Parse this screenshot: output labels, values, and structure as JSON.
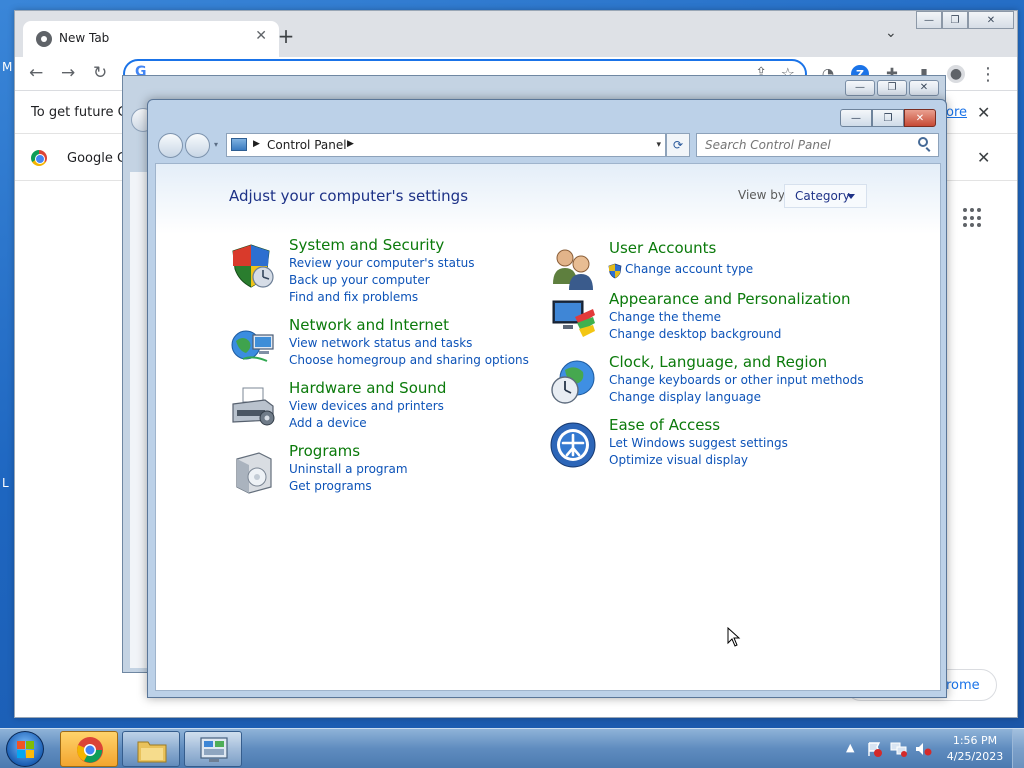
{
  "desktop": {
    "frag_left_top": "M",
    "frag_left_mid": "L"
  },
  "chrome": {
    "tab_title": "New Tab",
    "tab_close": "✕",
    "new_tab": "+",
    "tab_search": "⌄",
    "win_min": "—",
    "win_max": "❐",
    "win_close": "✕",
    "back": "←",
    "forward": "→",
    "reload": "↻",
    "omnibox_g": "G",
    "omnibox_value": "",
    "share": "⇪",
    "star": "☆",
    "ext1": "◔",
    "ext_z": "Z",
    "puzzle": "✚",
    "sidepanel": "▮",
    "profile": "●",
    "menu": "⋮",
    "info_text": "To get future Go",
    "info_more": "ore",
    "info_close": "✕",
    "bookmark_text": "Google Cl",
    "bookmark_close": "✕",
    "customize_text": "rome"
  },
  "bgwin": {
    "min": "—",
    "max": "❐",
    "close": "✕"
  },
  "control_panel": {
    "win_min": "—",
    "win_max": "❐",
    "win_close": "✕",
    "nav_drop": "▾",
    "address_root": "Control Panel",
    "address_dropdown": "▾",
    "refresh": "⟳",
    "search_placeholder": "Search Control Panel",
    "heading": "Adjust your computer's settings",
    "view_by_label": "View by:",
    "view_by_value": "Category",
    "categories_left": [
      {
        "title": "System and Security",
        "links": [
          "Review your computer's status",
          "Back up your computer",
          "Find and fix problems"
        ]
      },
      {
        "title": "Network and Internet",
        "links": [
          "View network status and tasks",
          "Choose homegroup and sharing options"
        ]
      },
      {
        "title": "Hardware and Sound",
        "links": [
          "View devices and printers",
          "Add a device"
        ]
      },
      {
        "title": "Programs",
        "links": [
          "Uninstall a program",
          "Get programs"
        ]
      }
    ],
    "categories_right": [
      {
        "title": "User Accounts",
        "links": [
          "Change account type"
        ]
      },
      {
        "title": "Appearance and Personalization",
        "links": [
          "Change the theme",
          "Change desktop background"
        ]
      },
      {
        "title": "Clock, Language, and Region",
        "links": [
          "Change keyboards or other input methods",
          "Change display language"
        ]
      },
      {
        "title": "Ease of Access",
        "links": [
          "Let Windows suggest settings",
          "Optimize visual display"
        ]
      }
    ]
  },
  "taskbar": {
    "tray_arrow": "▲",
    "clock_time": "1:56 PM",
    "clock_date": "4/25/2023"
  }
}
